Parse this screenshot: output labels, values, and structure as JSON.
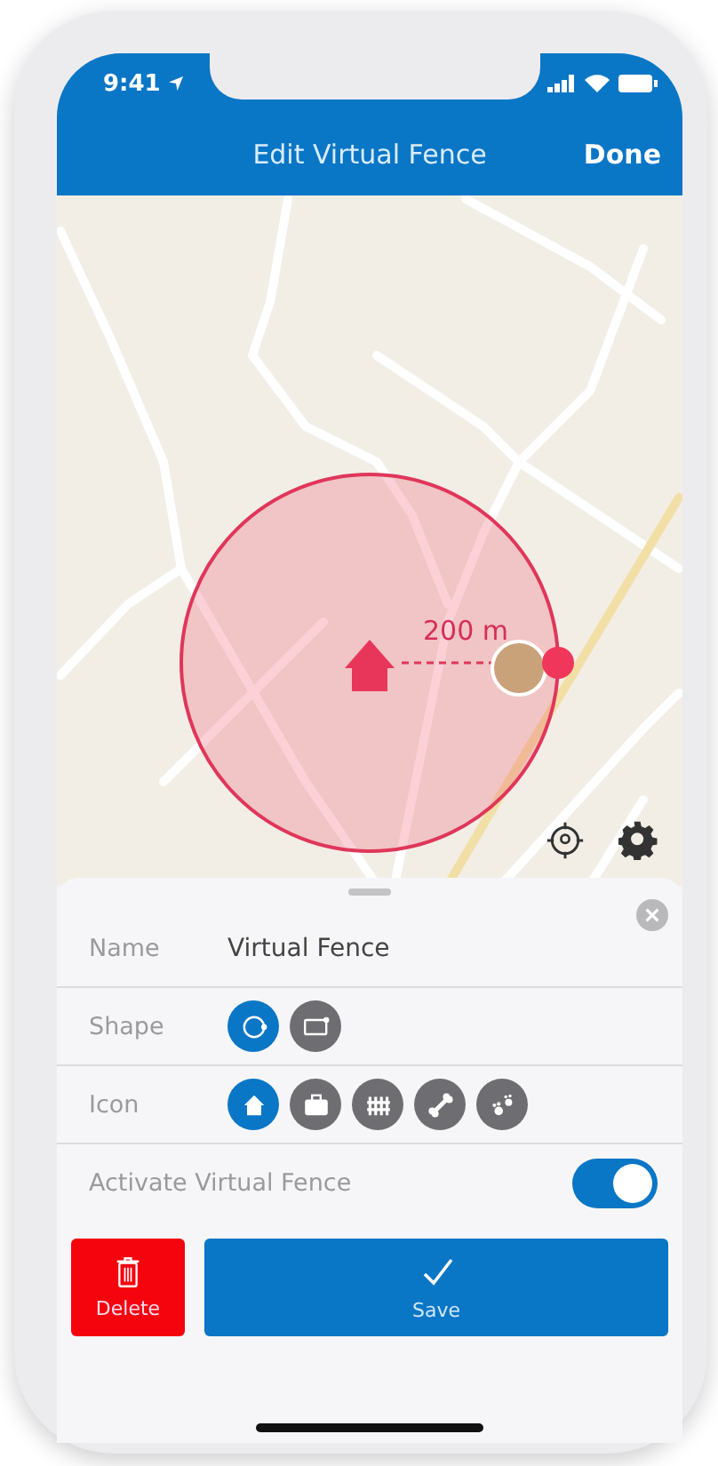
{
  "status_bar": {
    "time": "9:41"
  },
  "header": {
    "title": "Edit Virtual Fence",
    "done": "Done"
  },
  "map": {
    "radius_label": "200 m"
  },
  "sheet": {
    "name": {
      "label": "Name",
      "value": "Virtual Fence"
    },
    "shape": {
      "label": "Shape",
      "options": [
        {
          "kind": "circle",
          "selected": true
        },
        {
          "kind": "rectangle",
          "selected": false
        }
      ]
    },
    "icon": {
      "label": "Icon",
      "options": [
        {
          "kind": "home",
          "selected": true
        },
        {
          "kind": "briefcase",
          "selected": false
        },
        {
          "kind": "fence",
          "selected": false
        },
        {
          "kind": "bone",
          "selected": false
        },
        {
          "kind": "paw",
          "selected": false
        }
      ]
    },
    "activate": {
      "label": "Activate Virtual Fence",
      "on": true
    }
  },
  "actions": {
    "delete": "Delete",
    "save": "Save"
  }
}
